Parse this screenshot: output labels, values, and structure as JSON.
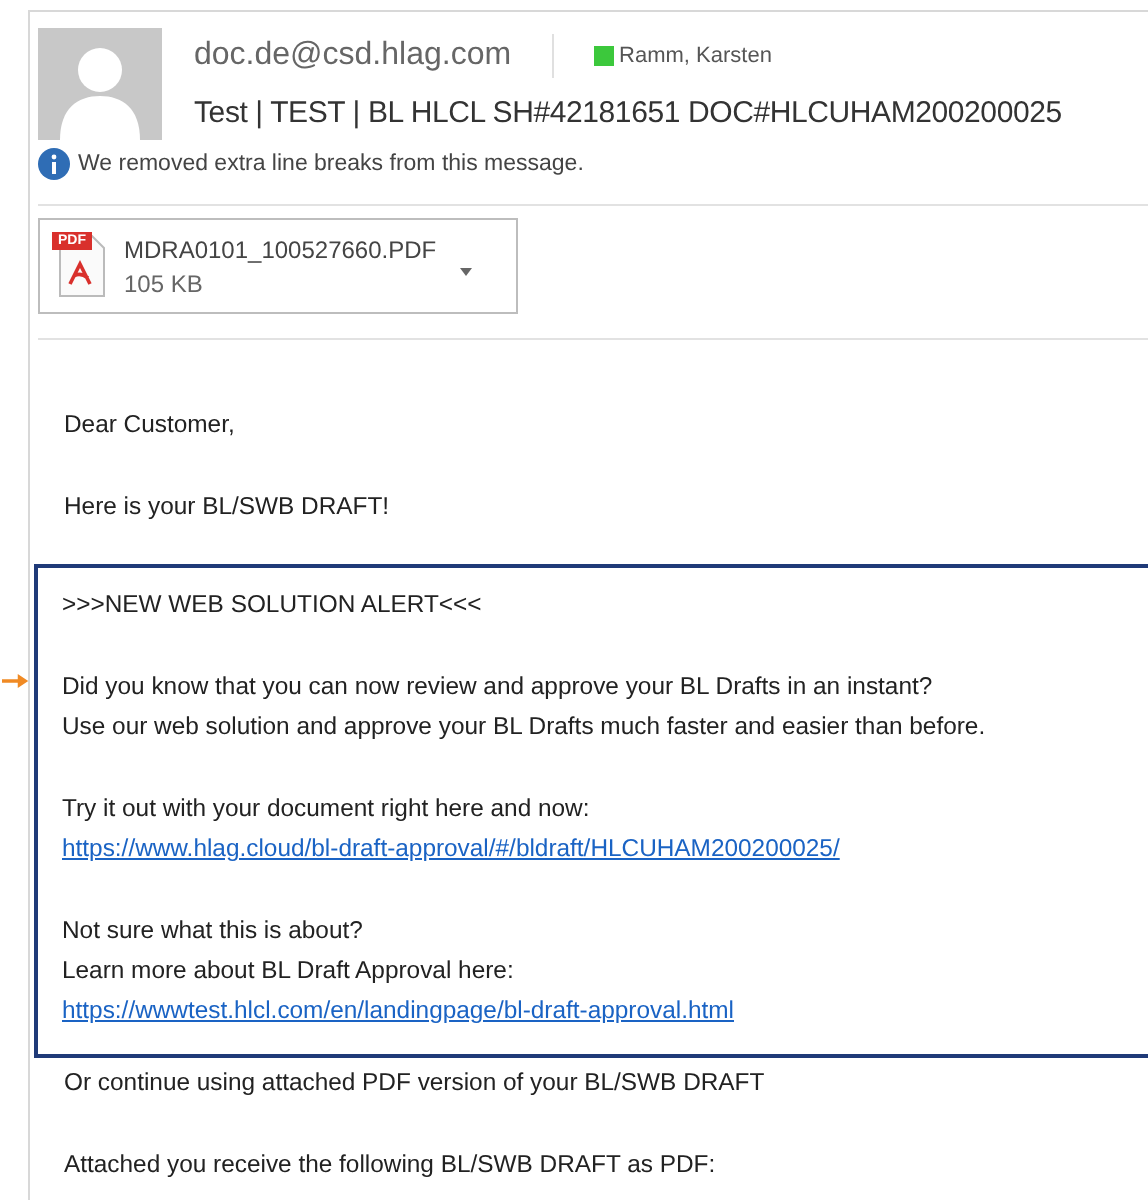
{
  "header": {
    "sender": "doc.de@csd.hlag.com",
    "recipient": {
      "name": "Ramm, Karsten",
      "color": "#3cc83c"
    },
    "subject": "Test | TEST | BL HLCL SH#42181651 DOC#HLCUHAM200200025"
  },
  "info_bar": "We removed extra line breaks from this message.",
  "attachment": {
    "name": "MDRA0101_100527660.PDF",
    "size": "105 KB",
    "badge": "PDF"
  },
  "body": [
    {
      "kind": "text",
      "text": "Dear Customer,"
    },
    {
      "kind": "text",
      "text": "Here is your BL/SWB DRAFT!"
    },
    {
      "kind": "alert",
      "paragraphs": [
        [
          {
            "kind": "text",
            "text": ">>>NEW WEB SOLUTION ALERT<<<"
          }
        ],
        [
          {
            "kind": "text",
            "text": "Did you know that you can now review and approve your BL Drafts in an instant?"
          },
          {
            "kind": "text",
            "text": "Use our web solution and approve your BL Drafts much faster and easier than before."
          }
        ],
        [
          {
            "kind": "text",
            "text": "Try it out with your document right here and now:"
          },
          {
            "kind": "link",
            "text": "https://www.hlag.cloud/bl-draft-approval/#/bldraft/HLCUHAM200200025/"
          }
        ],
        [
          {
            "kind": "text",
            "text": "Not sure what this is about?"
          },
          {
            "kind": "text",
            "text": "Learn more about BL Draft Approval here:"
          },
          {
            "kind": "link",
            "text": "https://wwwtest.hlcl.com/en/landingpage/bl-draft-approval.html"
          }
        ]
      ]
    },
    {
      "kind": "tight",
      "text": "Or continue using attached PDF version of your BL/SWB DRAFT"
    },
    {
      "kind": "text",
      "text": "Attached you receive the following BL/SWB DRAFT as PDF:"
    }
  ]
}
